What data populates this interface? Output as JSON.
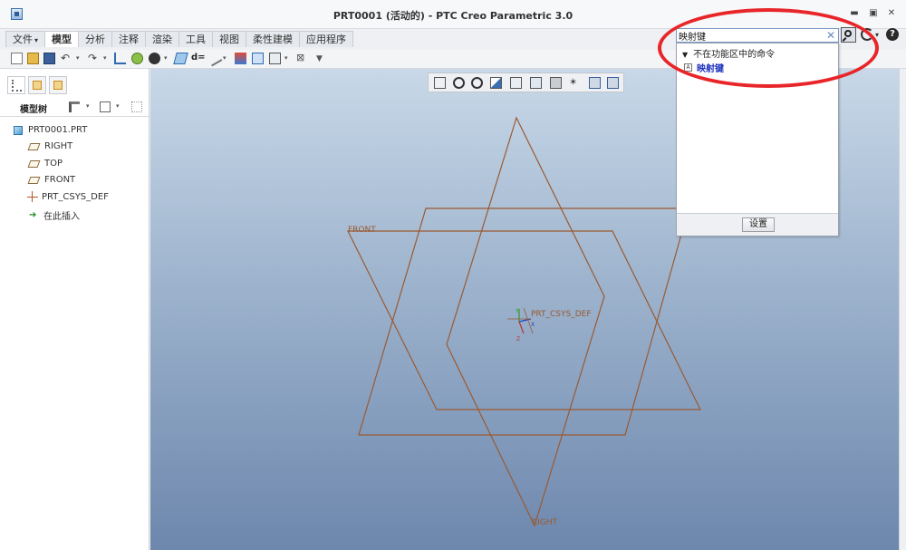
{
  "window": {
    "title": "PRT0001 (活动的) - PTC Creo Parametric 3.0",
    "minimize": "▬",
    "maximize": "▣",
    "close": "✕"
  },
  "ribbon": {
    "tabs": [
      {
        "label": "文件",
        "has_dropdown": true,
        "active": false
      },
      {
        "label": "模型",
        "active": true
      },
      {
        "label": "分析",
        "active": false
      },
      {
        "label": "注释",
        "active": false
      },
      {
        "label": "渲染",
        "active": false
      },
      {
        "label": "工具",
        "active": false
      },
      {
        "label": "视图",
        "active": false
      },
      {
        "label": "柔性建模",
        "active": false
      },
      {
        "label": "应用程序",
        "active": false
      }
    ]
  },
  "search": {
    "value": "映射键",
    "clear_icon": "✕",
    "help_label": "?",
    "dropdown": {
      "section_header": "不在功能区中的命令",
      "results": [
        {
          "label": "映射键",
          "icon": "mapkey-icon"
        }
      ],
      "settings_button": "设置"
    }
  },
  "model_tree": {
    "title": "模型树",
    "items": [
      {
        "label": "PRT0001.PRT",
        "icon": "part-icon"
      },
      {
        "label": "RIGHT",
        "icon": "datum-plane-icon"
      },
      {
        "label": "TOP",
        "icon": "datum-plane-icon"
      },
      {
        "label": "FRONT",
        "icon": "datum-plane-icon"
      },
      {
        "label": "PRT_CSYS_DEF",
        "icon": "csys-icon"
      },
      {
        "label": "在此插入",
        "icon": "insert-here-icon"
      }
    ]
  },
  "graphics": {
    "labels": {
      "front": "FRONT",
      "right": "RIGHT",
      "csys": "PRT_CSYS_DEF",
      "axis_x": "X",
      "axis_y": "Y",
      "axis_z": "Z"
    },
    "datum_color": "#9a5a32"
  },
  "colors": {
    "annotation_circle": "#e8262a",
    "search_result_link": "#1a2ebd",
    "viewport_top": "#c8d8e8",
    "viewport_bottom": "#6d87ad"
  }
}
